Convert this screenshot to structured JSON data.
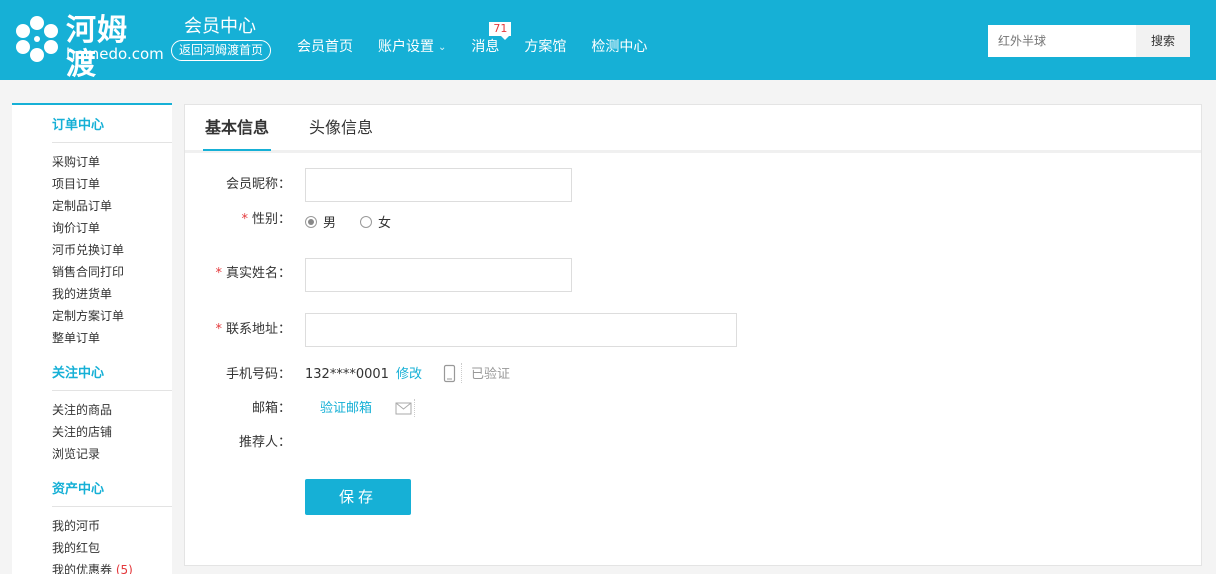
{
  "header": {
    "logo_cn": "河姆渡",
    "logo_en": "homedo.com",
    "member_title": "会员中心",
    "back_home": "返回河姆渡首页",
    "nav": [
      {
        "label": "会员首页"
      },
      {
        "label": "账户设置"
      },
      {
        "label": "消息",
        "badge": "71"
      },
      {
        "label": "方案馆"
      },
      {
        "label": "检测中心"
      }
    ],
    "search": {
      "placeholder": "红外半球",
      "button": "搜索"
    }
  },
  "sidebar": {
    "groups": [
      {
        "title": "订单中心",
        "items": [
          "采购订单",
          "项目订单",
          "定制品订单",
          "询价订单",
          "河币兑换订单",
          "销售合同打印",
          "我的进货单",
          "定制方案订单",
          "整单订单"
        ]
      },
      {
        "title": "关注中心",
        "items": [
          "关注的商品",
          "关注的店铺",
          "浏览记录"
        ]
      },
      {
        "title": "资产中心",
        "items": [
          "我的河币",
          "我的红包",
          "我的优惠券"
        ],
        "coupon_count": "(5)"
      }
    ]
  },
  "tabs": [
    {
      "label": "基本信息",
      "active": true
    },
    {
      "label": "头像信息",
      "active": false
    }
  ],
  "form": {
    "nickname_label": "会员昵称：",
    "nickname_value": "",
    "gender_label": "性别：",
    "gender_options": [
      "男",
      "女"
    ],
    "gender_selected": "男",
    "realname_label": "真实姓名：",
    "realname_value": "",
    "address_label": "联系地址：",
    "address_value": "",
    "phone_label": "手机号码：",
    "phone_value": "132****0001",
    "phone_modify": "修改",
    "phone_verified": "已验证",
    "email_label": "邮箱：",
    "email_verify": "验证邮箱",
    "referrer_label": "推荐人：",
    "required_mark": "*",
    "save_label": "保存"
  },
  "colors": {
    "brand": "#16b0d6",
    "required": "#e4393c"
  }
}
